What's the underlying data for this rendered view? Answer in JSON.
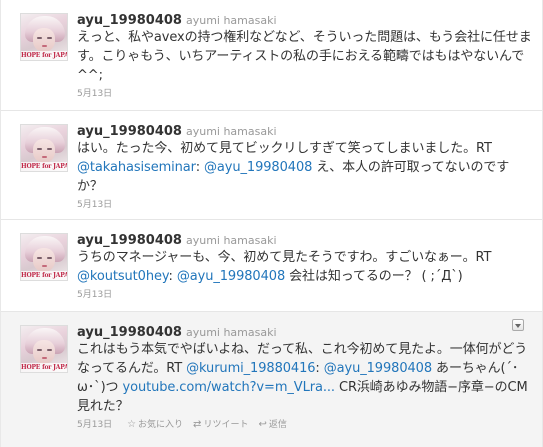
{
  "tweets": [
    {
      "screen_name": "ayu_19980408",
      "full_name": "ayumi hamasaki",
      "avatar_caption": "HOPE for JAPAN",
      "text": "えっと、私やavexの持つ権利などなど、そういった問題は、もう会社に任せます。こりゃもう、いちアーティストの私の手におえる範疇ではもはやないんで^^;",
      "date": "5月13日"
    },
    {
      "screen_name": "ayu_19980408",
      "full_name": "ayumi hamasaki",
      "avatar_caption": "HOPE for JAPAN",
      "text_before": "はい。たった今、初めて見てビックリしすぎて笑ってしまいました。RT ",
      "mention1": "@takahasiseminar",
      "text_mid": ": ",
      "mention2": "@ayu_19980408",
      "text_after": " え、本人の許可取ってないのですか？",
      "date": "5月13日"
    },
    {
      "screen_name": "ayu_19980408",
      "full_name": "ayumi hamasaki",
      "avatar_caption": "HOPE for JAPAN",
      "text_before": "うちのマネージャーも、今、初めて見たそうですわ。すごいなぁー。RT ",
      "mention1": "@koutsut0hey",
      "text_mid": ": ",
      "mention2": "@ayu_19980408",
      "text_after": " 会社は知ってるのー？ ( ;´Д`)",
      "date": "5月13日"
    },
    {
      "screen_name": "ayu_19980408",
      "full_name": "ayumi hamasaki",
      "avatar_caption": "HOPE for JAPAN",
      "text_before": "これはもう本気でやばいよね、だって私、これ今初めて見たよ。一体何がどうなってるんだ。RT ",
      "mention1": "@kurumi_19880416",
      "text_mid": ": ",
      "mention2": "@ayu_19980408",
      "text_after": " あーちゃん(´･ω･`)つ ",
      "link": "youtube.com/watch?v=m_VLra...",
      "text_end": " CR浜崎あゆみ物語−序章−のCM見れた？",
      "date": "5月13日",
      "actions": {
        "favorite": "お気に入り",
        "retweet": "リツイート",
        "reply": "返信"
      }
    }
  ]
}
